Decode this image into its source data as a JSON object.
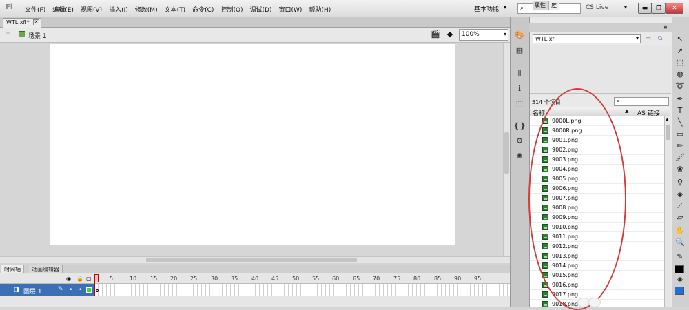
{
  "app": {
    "logo": "Fl"
  },
  "menu": [
    "文件(F)",
    "编辑(E)",
    "视图(V)",
    "插入(I)",
    "修改(M)",
    "文本(T)",
    "命令(C)",
    "控制(O)",
    "调试(D)",
    "窗口(W)",
    "帮助(H)"
  ],
  "workspace": {
    "label": "基本功能"
  },
  "search": {
    "placeholder": ""
  },
  "cslive": {
    "label": "CS Live"
  },
  "document": {
    "tab_name": "WTL.xfl*"
  },
  "scene": {
    "label": "场景 1"
  },
  "zoom": {
    "value": "100%"
  },
  "timeline": {
    "tabs": [
      "时间轴",
      "动画编辑器"
    ],
    "ruler": [
      "5",
      "10",
      "15",
      "20",
      "25",
      "30",
      "35",
      "40",
      "45",
      "50",
      "55",
      "60",
      "65",
      "70",
      "75",
      "80",
      "85",
      "90",
      "95"
    ],
    "layer_name": "图层 1"
  },
  "panel": {
    "tabs": [
      "属性",
      "库"
    ],
    "doc_select": "WTL.xfl",
    "item_count": "514 个项目",
    "col_name": "名称",
    "col_link": "AS 链接"
  },
  "library_items": [
    "9000L.png",
    "9000R.png",
    "9001.png",
    "9002.png",
    "9003.png",
    "9004.png",
    "9005.png",
    "9006.png",
    "9007.png",
    "9008.png",
    "9009.png",
    "9010.png",
    "9011.png",
    "9012.png",
    "9013.png",
    "9014.png",
    "9015.png",
    "9016.png",
    "9017.png",
    "9018.png"
  ],
  "colors": {
    "layer_selected": "#3b6fb6",
    "annotation": "#d63a3a",
    "fill_swatch": "#1f6fd6"
  }
}
